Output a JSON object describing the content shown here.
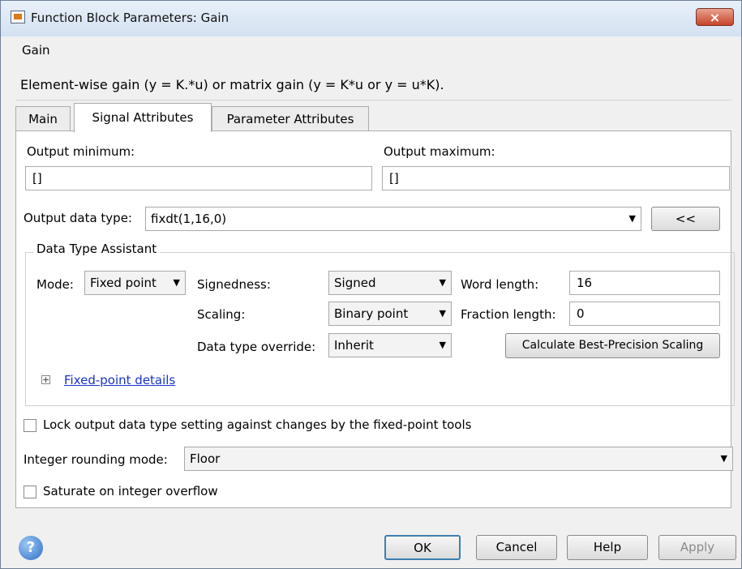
{
  "window": {
    "title": "Function Block Parameters: Gain",
    "close_glyph": "×"
  },
  "header": {
    "group_label": "Gain",
    "description": "Element-wise gain (y = K.*u) or matrix gain (y = K*u or y = u*K)."
  },
  "tabs": [
    {
      "label": "Main",
      "active": false
    },
    {
      "label": "Signal Attributes",
      "active": true
    },
    {
      "label": "Parameter Attributes",
      "active": false
    }
  ],
  "signal": {
    "output_min_label": "Output minimum:",
    "output_min_value": "[]",
    "output_max_label": "Output maximum:",
    "output_max_value": "[]",
    "output_type_label": "Output data type:",
    "output_type_value": "fixdt(1,16,0)",
    "assistant_toggle": "<<"
  },
  "assistant": {
    "legend": "Data Type Assistant",
    "mode_label": "Mode:",
    "mode_value": "Fixed point",
    "signedness_label": "Signedness:",
    "signedness_value": "Signed",
    "word_length_label": "Word length:",
    "word_length_value": "16",
    "scaling_label": "Scaling:",
    "scaling_value": "Binary point",
    "fraction_length_label": "Fraction length:",
    "fraction_length_value": "0",
    "override_label": "Data type override:",
    "override_value": "Inherit",
    "calc_button": "Calculate Best-Precision Scaling",
    "details_expander": "+",
    "details_link": "Fixed-point details"
  },
  "options": {
    "lock_label": "Lock output data type setting against changes by the fixed-point tools",
    "rounding_label": "Integer rounding mode:",
    "rounding_value": "Floor",
    "saturate_label": "Saturate on integer overflow"
  },
  "footer": {
    "help_icon_glyph": "?",
    "ok": "OK",
    "cancel": "Cancel",
    "help": "Help",
    "apply": "Apply"
  },
  "icons": [
    "app-icon",
    "close-icon",
    "dropdown-arrow-icon",
    "help-circle-icon",
    "expand-plus-icon"
  ],
  "colors": {
    "link": "#1a33c7",
    "close_button": "#c7442a",
    "ok_border": "#3c7fb1"
  }
}
